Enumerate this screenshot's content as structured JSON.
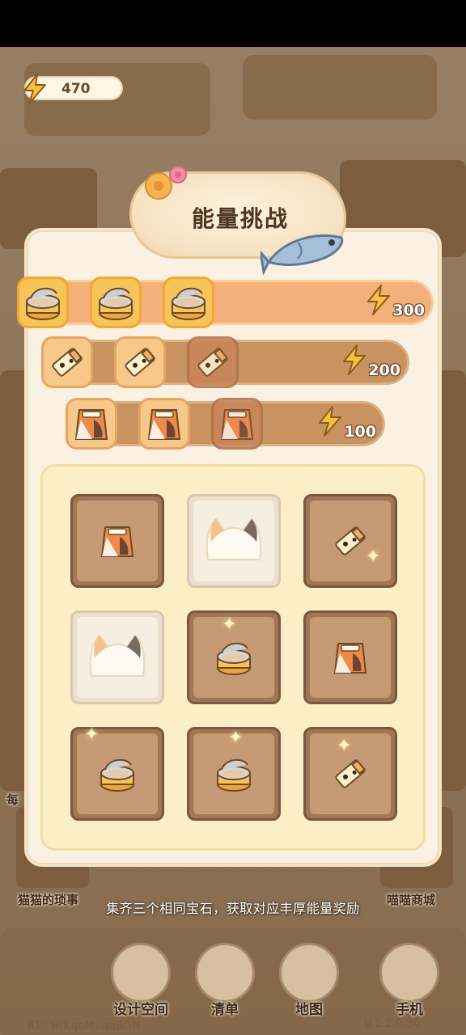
{
  "hud": {
    "energy": "470"
  },
  "dialog": {
    "title": "能量挑战",
    "rewards": [
      {
        "item": "can",
        "amount": "300",
        "collected": 3
      },
      {
        "item": "treat-stick",
        "amount": "200",
        "collected": 2
      },
      {
        "item": "food-bag",
        "amount": "100",
        "collected": 2
      }
    ],
    "board": [
      [
        "food-bag",
        "cat-face",
        "treat-stick"
      ],
      [
        "cat-face",
        "can",
        "food-bag"
      ],
      [
        "can",
        "can",
        "treat-stick"
      ]
    ],
    "hint": "集齐三个相同宝石，获取对应丰厚能量奖励"
  },
  "side_labels": {
    "left": "猫猫的琐事",
    "left_top": "每",
    "right": "喵喵商城"
  },
  "nav": [
    {
      "label": "设计空间",
      "icon": "design-icon"
    },
    {
      "label": "清单",
      "icon": "checklist-icon"
    },
    {
      "label": "地图",
      "icon": "map-pin-icon"
    },
    {
      "label": "手机",
      "icon": "phone-icon"
    }
  ],
  "footer": {
    "id": "ID：HfKqoMvqaBON",
    "version": "V.1.2.0.36"
  },
  "colors": {
    "accent": "#f4b07a",
    "board": "#fcefc8",
    "cell": "#a07656",
    "title": "#4c3522"
  }
}
